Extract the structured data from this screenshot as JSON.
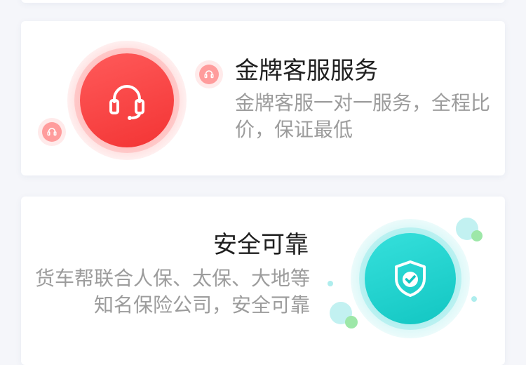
{
  "services": [
    {
      "title": "金牌客服服务",
      "description": "金牌客服一对一服务，全程比价，保证最低",
      "icon": "headset-icon",
      "color": "#f33434"
    },
    {
      "title": "安全可靠",
      "description": "货车帮联合人保、太保、大地等 知名保险公司，安全可靠",
      "icon": "shield-check-icon",
      "color": "#12c6c2"
    }
  ]
}
